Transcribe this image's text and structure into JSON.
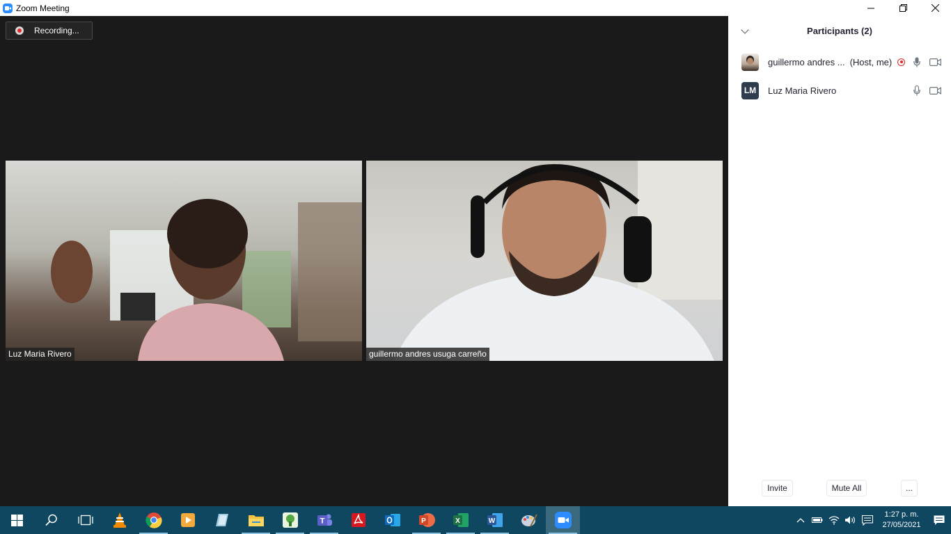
{
  "window": {
    "title": "Zoom Meeting",
    "controls": {
      "minimize_icon": "minimize-icon",
      "restore_icon": "restore-icon",
      "close_icon": "close-icon"
    }
  },
  "meeting": {
    "recording_label": "Recording...",
    "videos": [
      {
        "name": "Luz Maria Rivero"
      },
      {
        "name": "guillermo andres usuga carreño"
      }
    ]
  },
  "participants_panel": {
    "title": "Participants (2)",
    "participants": [
      {
        "name": "guillermo andres ...",
        "role": "(Host, me)",
        "avatar": "photo",
        "recording": true,
        "mic": "unmuted",
        "video": "off"
      },
      {
        "name": "Luz Maria Rivero",
        "role": "",
        "avatar": "LM",
        "recording": false,
        "mic": "unmuted",
        "video": "off"
      }
    ],
    "buttons": {
      "invite": "Invite",
      "mute_all": "Mute All",
      "more": "..."
    }
  },
  "taskbar": {
    "apps": [
      {
        "name": "start",
        "icon": "windows-icon"
      },
      {
        "name": "search",
        "icon": "search-icon"
      },
      {
        "name": "task-view",
        "icon": "task-view-icon"
      },
      {
        "name": "vlc",
        "icon": "vlc-icon",
        "color": "#f08a00"
      },
      {
        "name": "chrome",
        "icon": "chrome-icon",
        "color": "#dd4b39",
        "running": true
      },
      {
        "name": "video-player",
        "icon": "video-player-icon",
        "color": "#f3a93b"
      },
      {
        "name": "notes",
        "icon": "notes-icon",
        "color": "#9ec9e0"
      },
      {
        "name": "file-explorer",
        "icon": "folder-icon",
        "color": "#f5c342",
        "running": true
      },
      {
        "name": "green-app",
        "icon": "green-app-icon",
        "color": "#53a842",
        "running": true
      },
      {
        "name": "teams",
        "icon": "teams-icon",
        "color": "#5b5fc7",
        "running": true
      },
      {
        "name": "acrobat",
        "icon": "acrobat-icon",
        "color": "#d7191f"
      },
      {
        "name": "outlook",
        "icon": "outlook-icon",
        "color": "#0f6cbd"
      },
      {
        "name": "powerpoint",
        "icon": "powerpoint-icon",
        "color": "#d24726",
        "running": true
      },
      {
        "name": "excel",
        "icon": "excel-icon",
        "color": "#1e7145",
        "running": true
      },
      {
        "name": "word",
        "icon": "word-icon",
        "color": "#2b579a",
        "running": true
      },
      {
        "name": "paint",
        "icon": "paint-icon",
        "color": "#c9d4de"
      },
      {
        "name": "zoom",
        "icon": "zoom-icon",
        "color": "#2d8cff",
        "active": true
      }
    ],
    "clock_time": "1:27 p. m.",
    "clock_date": "27/05/2021"
  }
}
